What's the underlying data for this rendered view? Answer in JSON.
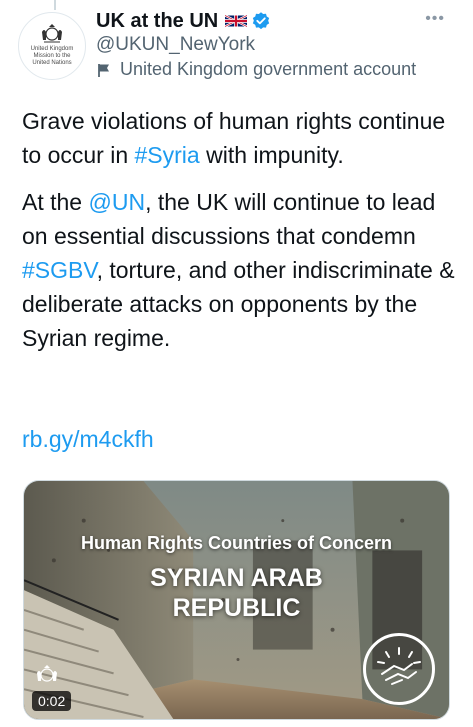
{
  "account": {
    "display_name": "UK at the UN",
    "handle": "@UKUN_NewYork",
    "label": "United Kingdom government account",
    "avatar_text": [
      "United Kingdom",
      "Mission to the",
      "United Nations"
    ],
    "verified_icon": "verified-badge-icon",
    "flag_icon": "uk-flag-icon"
  },
  "tweet": {
    "p1_a": "Grave violations of human rights continue to occur in ",
    "p1_hashtag": "#Syria",
    "p1_b": " with impunity.",
    "p2_a": "At the ",
    "p2_mention": "@UN",
    "p2_b": ", the UK will continue to lead on essential discussions that condemn ",
    "p2_hashtag": "#SGBV",
    "p2_c": ", torture, and other indiscriminate & deliberate attacks on opponents by the Syrian regime.",
    "link": "rb.gy/m4ckfh"
  },
  "media": {
    "title": "Human Rights Countries of Concern",
    "country_line1": "SYRIAN ARAB",
    "country_line2": "REPUBLIC",
    "timer": "0:02"
  },
  "colors": {
    "link": "#1d9bf0",
    "secondary_text": "#536471",
    "verified": "#1d9bf0"
  }
}
